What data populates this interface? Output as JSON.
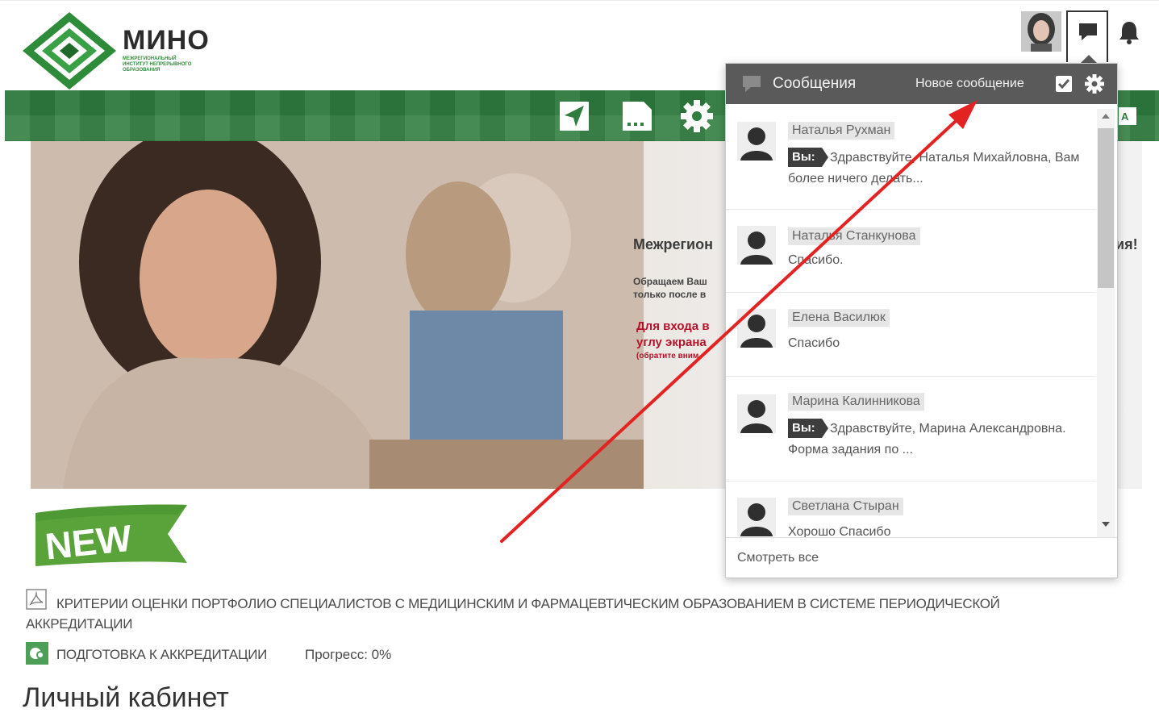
{
  "header": {
    "logo_title": "МИНО",
    "logo_subtitle": "межрегиональный институт непрерывного образования"
  },
  "hero": {
    "title": "Межрегион",
    "title_right": "ия!",
    "subtitle": "Обращаем Ваш\nтолько после в",
    "notice": "Для входа в\nуглу экрана",
    "notice_small": "(обратите вним"
  },
  "badge": {
    "label": "NEW"
  },
  "content": {
    "doc_link": "КРИТЕРИИ ОЦЕНКИ ПОРТФОЛИО СПЕЦИАЛИСТОВ С МЕДИЦИНСКИМ И ФАРМАЦЕВТИЧЕСКИМ ОБРАЗОВАНИЕМ В СИСТЕМЕ ПЕРИОДИЧЕСКОЙ АККРЕДИТАЦИИ",
    "accreditation_link": "ПОДГОТОВКА К АККРЕДИТАЦИИ",
    "progress": "Прогресс: 0%",
    "page_title": "Личный кабинет"
  },
  "messages_popover": {
    "title": "Сообщения",
    "new_message": "Новое сообщение",
    "view_all": "Смотреть все",
    "you_label": "Вы:",
    "items": [
      {
        "name": "Наталья Рухман",
        "from_you": true,
        "text": "Здравствуйте, Наталья Михайловна, Вам более ничего делать..."
      },
      {
        "name": "Наталья Станкунова",
        "from_you": false,
        "text": "Спасибо."
      },
      {
        "name": "Елена Василюк",
        "from_you": false,
        "text": "Спасибо"
      },
      {
        "name": "Марина Калинникова",
        "from_you": true,
        "text": "Здравствуйте, Марина Александровна. Форма задания по ..."
      },
      {
        "name": "Светлана Стыран",
        "from_you": false,
        "text": "Хорошо Спасибо"
      }
    ]
  },
  "colors": {
    "brand_green": "#2f7d3f",
    "popover_header": "#5a5a5a",
    "annotation_arrow": "#e32222",
    "notice_red": "#b3122b"
  },
  "icons": {
    "nav": [
      "send-icon",
      "sd-card-icon",
      "gear-icon"
    ],
    "header": [
      "messages-icon",
      "bell-icon"
    ],
    "language": "translate-icon"
  }
}
